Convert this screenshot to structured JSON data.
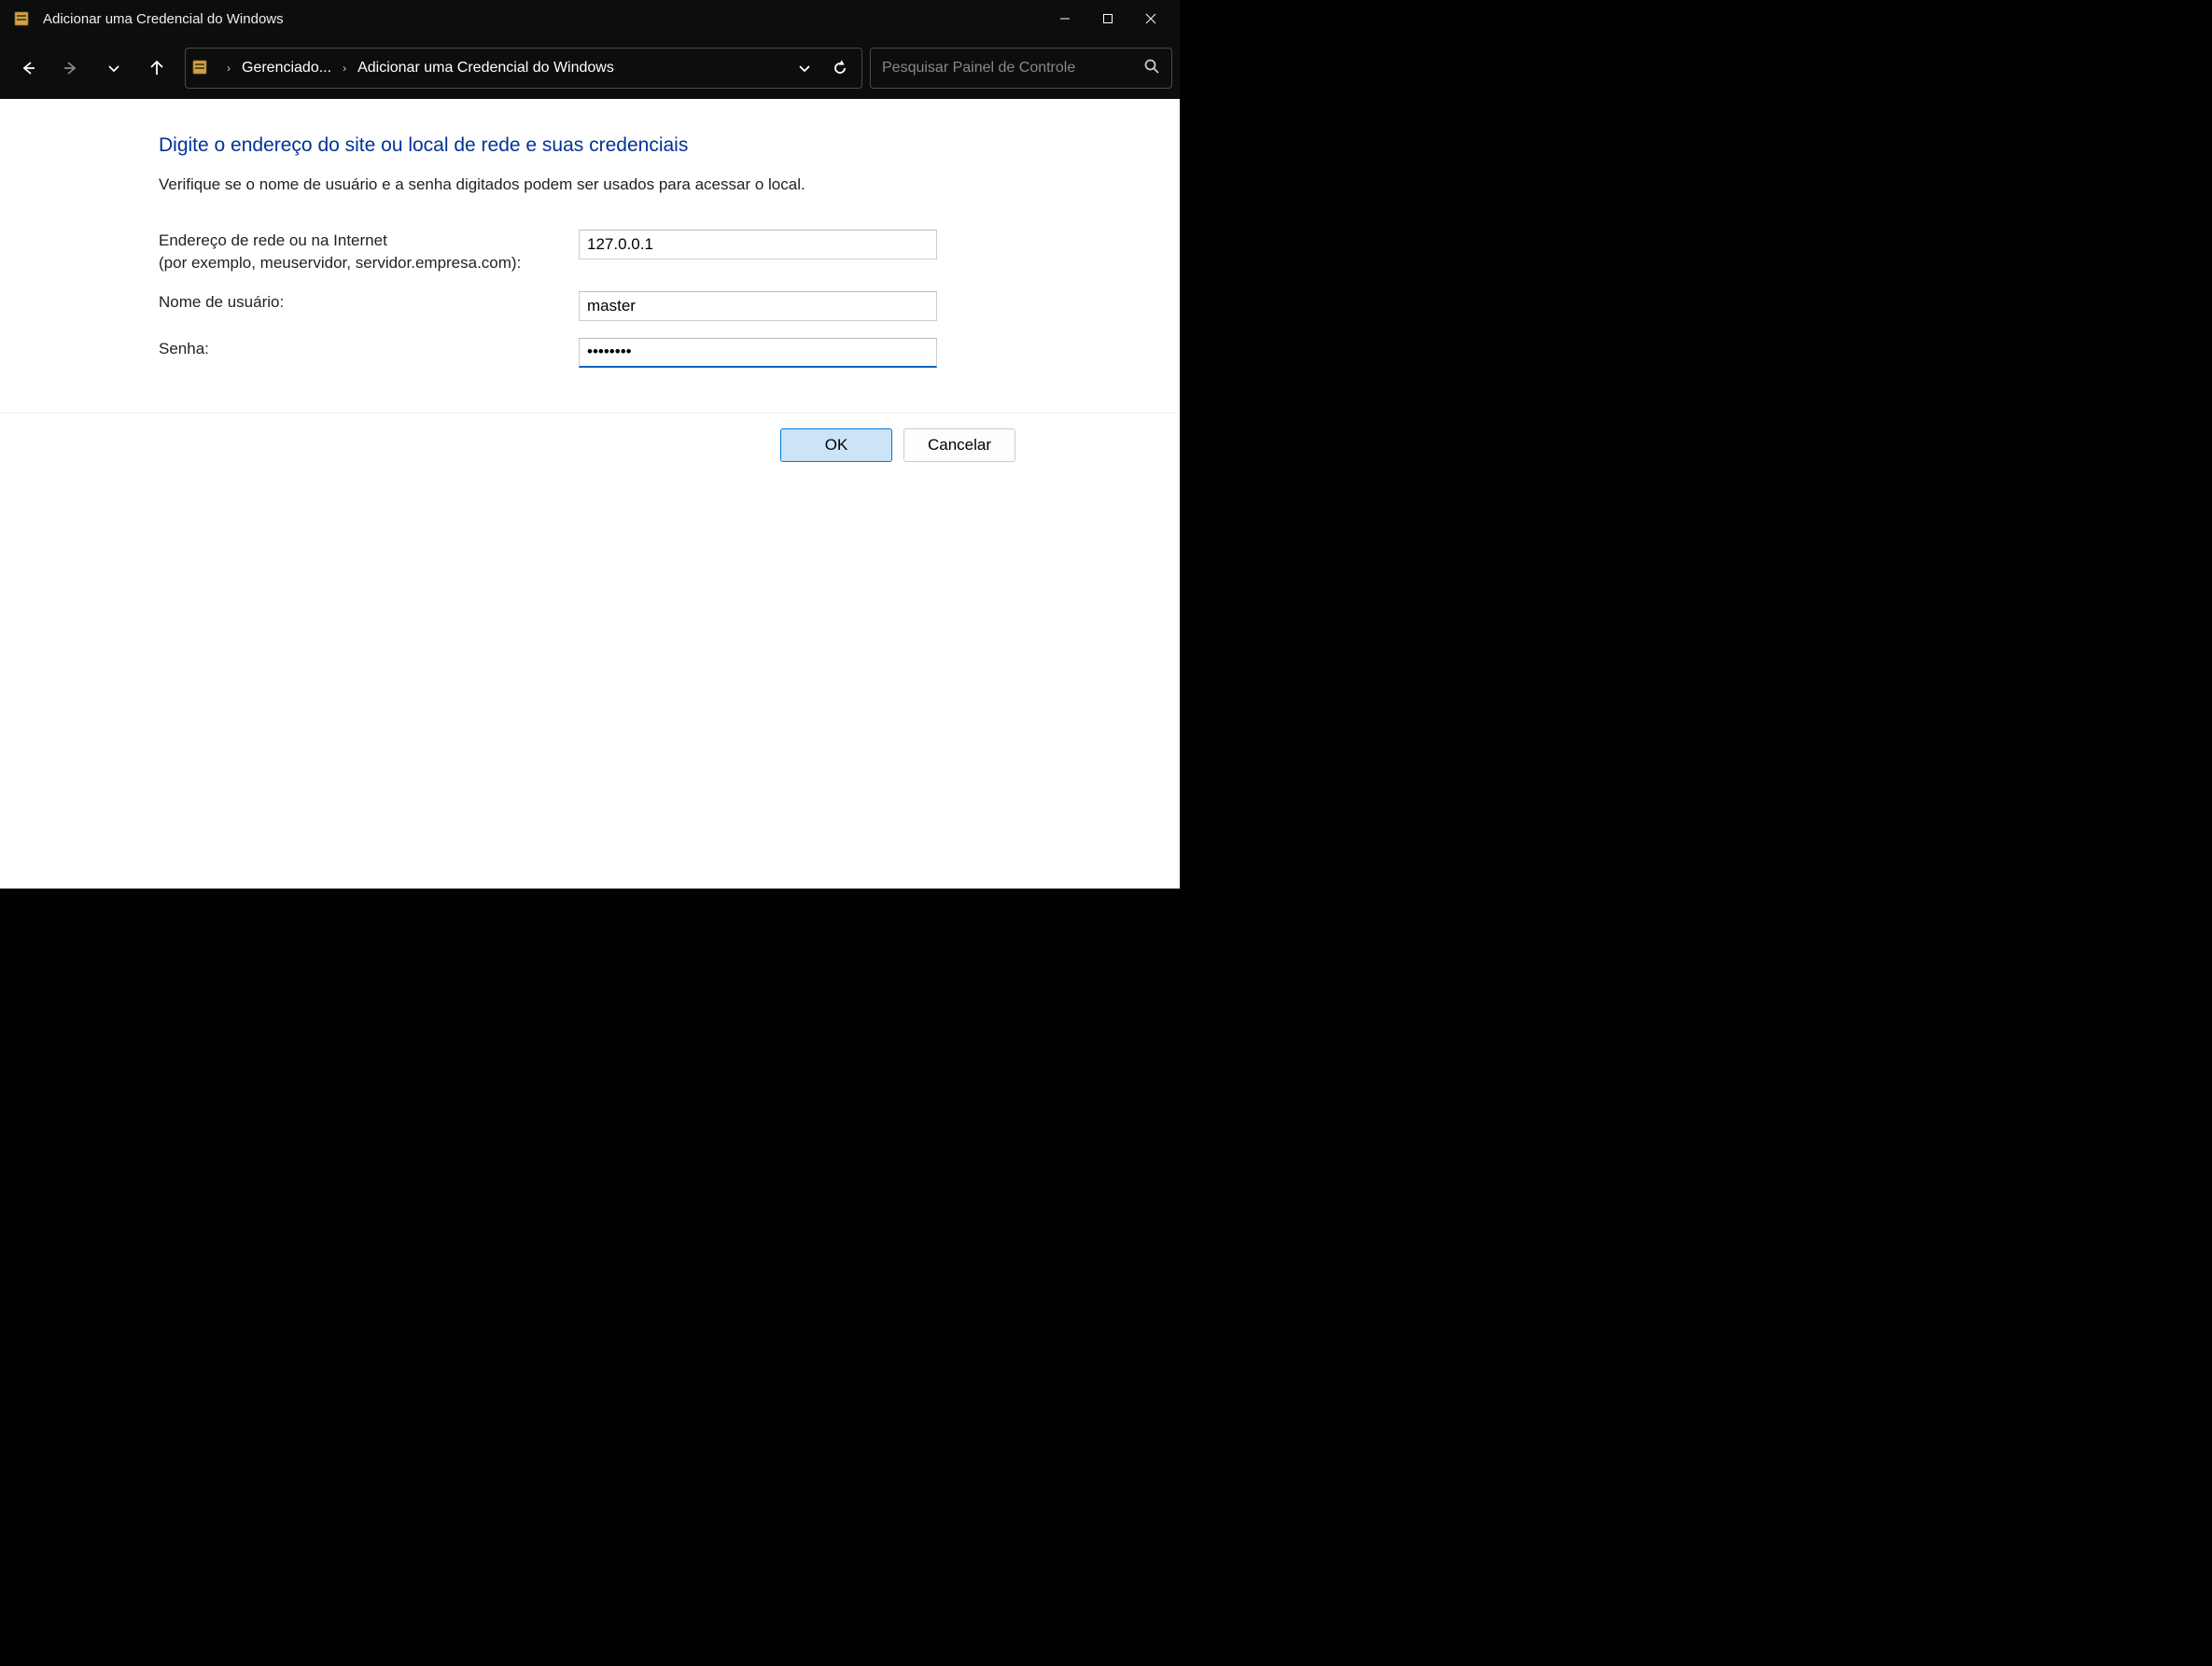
{
  "titlebar": {
    "title": "Adicionar uma Credencial do Windows"
  },
  "breadcrumb": {
    "item1": "Gerenciado...",
    "item2": "Adicionar uma Credencial do Windows"
  },
  "search": {
    "placeholder": "Pesquisar Painel de Controle"
  },
  "content": {
    "title": "Digite o endereço do site ou local de rede e suas credenciais",
    "subtitle": "Verifique se o nome de usuário e a senha digitados podem ser usados para acessar o local.",
    "labels": {
      "address_line1": "Endereço de rede ou na Internet",
      "address_line2": "(por exemplo, meuservidor, servidor.empresa.com):",
      "username": "Nome de usuário:",
      "password": "Senha:"
    },
    "values": {
      "address": "127.0.0.1",
      "username": "master",
      "password": "••••••••"
    }
  },
  "buttons": {
    "ok": "OK",
    "cancel": "Cancelar"
  }
}
